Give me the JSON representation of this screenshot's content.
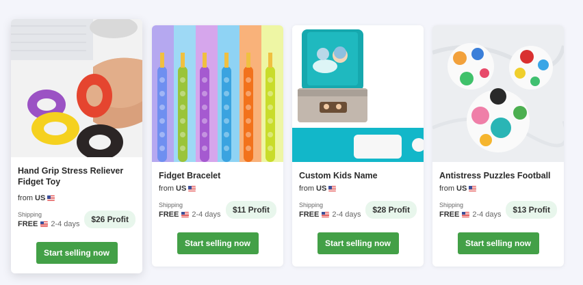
{
  "products": [
    {
      "title": "Hand Grip Stress Reliever Fidget Toy",
      "from_label": "from",
      "from_country": "US",
      "shipping_label": "Shipping",
      "shipping_value": "FREE",
      "shipping_days": "2-4 days",
      "profit": "$26 Profit",
      "cta": "Start selling now"
    },
    {
      "title": "Fidget Bracelet",
      "from_label": "from",
      "from_country": "US",
      "shipping_label": "Shipping",
      "shipping_value": "FREE",
      "shipping_days": "2-4 days",
      "profit": "$11 Profit",
      "cta": "Start selling now"
    },
    {
      "title": "Custom Kids Name",
      "from_label": "from",
      "from_country": "US",
      "shipping_label": "Shipping",
      "shipping_value": "FREE",
      "shipping_days": "2-4 days",
      "profit": "$28 Profit",
      "cta": "Start selling now"
    },
    {
      "title": "Antistress Puzzles Football",
      "from_label": "from",
      "from_country": "US",
      "shipping_label": "Shipping",
      "shipping_value": "FREE",
      "shipping_days": "2-4 days",
      "profit": "$13 Profit",
      "cta": "Start selling now"
    }
  ],
  "colors": {
    "button": "#43a047",
    "profit_badge": "#e8f6ec",
    "background": "#f4f5fb"
  }
}
